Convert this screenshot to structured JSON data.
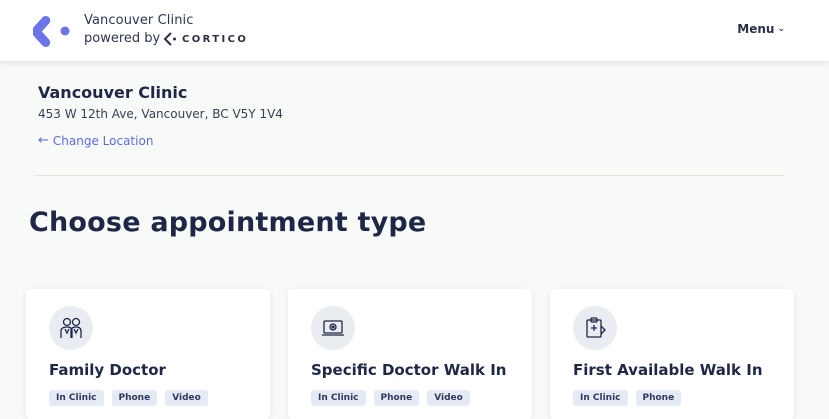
{
  "header": {
    "brand_name": "Vancouver Clinic",
    "powered_by": "powered by",
    "cortico": "CORTICO",
    "menu_label": "Menu",
    "brand_color": "#6c74e8"
  },
  "location": {
    "name": "Vancouver Clinic",
    "address": "453 W 12th Ave, Vancouver, BC V5Y 1V4",
    "change_label": "Change Location"
  },
  "main": {
    "heading": "Choose appointment type",
    "cards": [
      {
        "title": "Family Doctor",
        "icon": "family-doctor-icon",
        "tags": [
          "In Clinic",
          "Phone",
          "Video"
        ]
      },
      {
        "title": "Specific Doctor Walk In",
        "icon": "laptop-video-icon",
        "tags": [
          "In Clinic",
          "Phone",
          "Video"
        ]
      },
      {
        "title": "First Available Walk In",
        "icon": "clipboard-icon",
        "tags": [
          "In Clinic",
          "Phone"
        ]
      }
    ]
  }
}
